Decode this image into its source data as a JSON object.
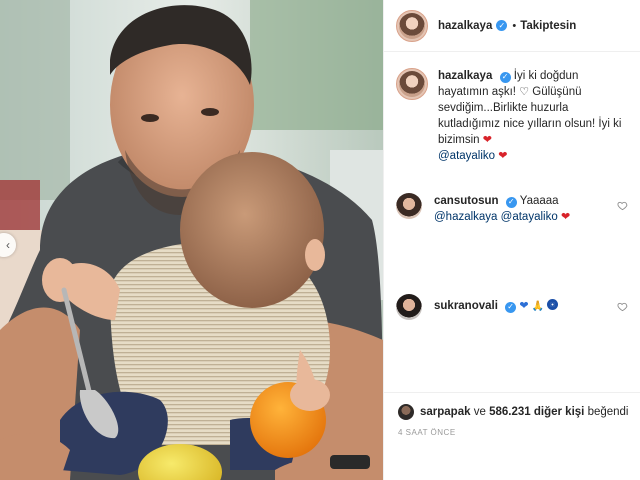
{
  "post": {
    "author": "hazalkaya",
    "follow_state": "Takiptesin",
    "separator": "•",
    "caption": {
      "author": "hazalkaya",
      "line1": "İyi ki doğdun hayatımın aşkı!",
      "line2": "Gülüşünü sevdiğim...Birlikte huzurla kutladığımız nice yılların olsun! İyi ki bizimsin",
      "mention": "@atayaliko",
      "heart": "❤",
      "outline_heart": "♡"
    },
    "comments": [
      {
        "username": "cansutosun",
        "verified": true,
        "text": "Yaaaaa",
        "mentions": [
          "@hazalkaya",
          "@atayaliko"
        ],
        "heart": "❤"
      },
      {
        "username": "sukranovali",
        "verified": true,
        "emoji": [
          "blue-heart",
          "folded-hands",
          "nazar-eye"
        ]
      }
    ],
    "likes": {
      "first_liker": "sarpapak",
      "joiner": "ve",
      "count": "586.231",
      "suffix": "diğer kişi",
      "verb": "beğendi"
    },
    "timestamp": "4 SAAT ÖNCE"
  },
  "icons": {
    "verified": "verified-badge-icon",
    "comment_like": "heart-outline-icon",
    "carousel_prev": "chevron-left-icon"
  },
  "colors": {
    "verified": "#3897f0",
    "mention": "#003569",
    "red_heart": "#d8232a",
    "timestamp": "#999999"
  }
}
